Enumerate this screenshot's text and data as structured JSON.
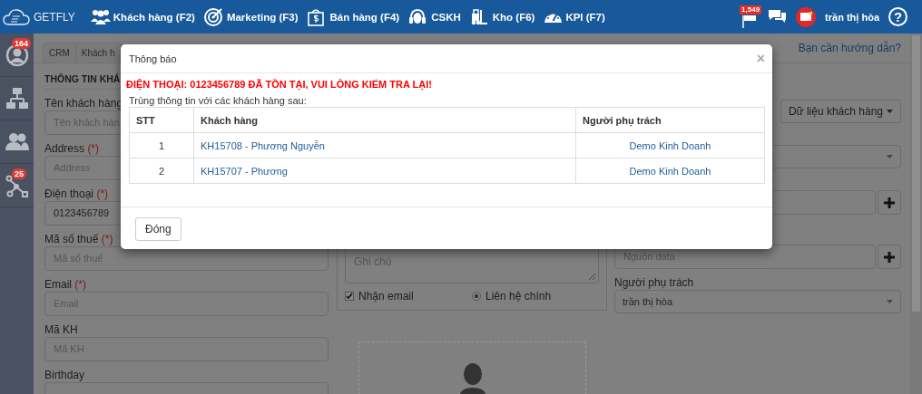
{
  "top_bar": {
    "logo": "GETFLY",
    "nav": [
      {
        "label": "Khách hàng (F2)"
      },
      {
        "label": "Marketing (F3)"
      },
      {
        "label": "Bán hàng (F4)"
      },
      {
        "label": "CSKH"
      },
      {
        "label": "Kho (F6)"
      },
      {
        "label": "KPI (F7)"
      }
    ],
    "notification_count": "1,549",
    "user": "trần thị hòa",
    "help": "?"
  },
  "sidebar": {
    "profile_badge": "164",
    "branch_badge": "25"
  },
  "breadcrumb": [
    "CRM",
    "Khách h"
  ],
  "help_link": "Bạn cần hướng dẫn?",
  "form": {
    "title": "THÔNG TIN KHÁ",
    "fields": [
      {
        "label": "Tên khách hàng",
        "placeholder": "Tên khách hàn"
      },
      {
        "label": "Address",
        "mark": "(*)",
        "placeholder": "Address"
      },
      {
        "label": "Điện thoại",
        "mark": "(*)",
        "value": "0123456789"
      },
      {
        "label": "Mã số thuế",
        "mark": "(*)",
        "placeholder": "Mã số thuế"
      },
      {
        "label": "Email",
        "mark": "(*)",
        "placeholder": "Email"
      },
      {
        "label": "Mã KH",
        "placeholder": "Mã KH"
      },
      {
        "label": "Birthday"
      }
    ]
  },
  "notes": {
    "placeholder": "Ghi chú"
  },
  "options": [
    {
      "kind": "checkbox",
      "label": "Nhận email",
      "checked": true
    },
    {
      "kind": "radio",
      "label": "Liên hệ chính",
      "selected": true
    }
  ],
  "data_button": "Dữ liệu khách hàng",
  "right_fields": [
    {
      "kind": "select"
    },
    {
      "kind": "input_add"
    },
    {
      "kind": "input_add",
      "placeholder": "Nguồn data"
    },
    {
      "kind": "select",
      "label": "Người phụ trách",
      "value": "trần thị hòa"
    }
  ],
  "dialog": {
    "title": "Thông báo",
    "close": "×",
    "error": "ĐIỆN THOẠI: 0123456789 ĐÃ TỒN TẠI, VUI LÒNG KIỂM TRA LẠI!",
    "subtitle": "Trùng thông tin với các khách hàng sau:",
    "columns": [
      "STT",
      "Khách hàng",
      "Người phụ trách"
    ],
    "rows": [
      [
        "1",
        "KH15708 - Phương Nguyễn",
        "Demo Kinh Doanh"
      ],
      [
        "2",
        "KH15707 - Phương",
        "Demo Kinh Doanh"
      ]
    ],
    "button": "Đóng"
  }
}
